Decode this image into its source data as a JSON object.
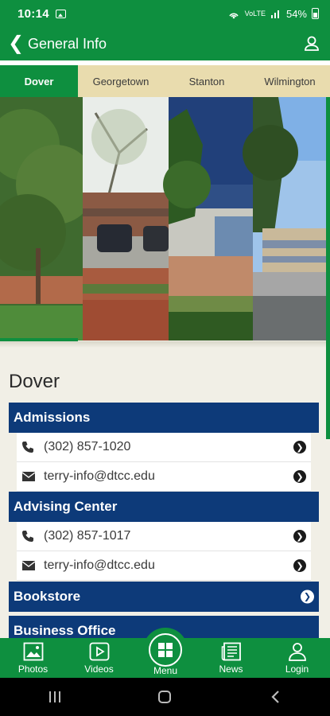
{
  "status_bar": {
    "time": "10:14",
    "signal_text": "VoLTE",
    "battery": "54%"
  },
  "app_bar": {
    "title": "General Info"
  },
  "tabs": [
    {
      "label": "Dover",
      "active": true
    },
    {
      "label": "Georgetown",
      "active": false
    },
    {
      "label": "Stanton",
      "active": false
    },
    {
      "label": "Wilmington",
      "active": false
    }
  ],
  "campus": {
    "name": "Dover"
  },
  "sections": {
    "admissions": {
      "title": "Admissions",
      "phone": "(302) 857-1020",
      "email": "terry-info@dtcc.edu"
    },
    "advising": {
      "title": "Advising Center",
      "phone": "(302) 857-1017",
      "email": "terry-info@dtcc.edu"
    },
    "bookstore": {
      "title": "Bookstore"
    },
    "business": {
      "title": "Business Office"
    }
  },
  "bottom_nav": {
    "photos": "Photos",
    "videos": "Videos",
    "menu": "Menu",
    "news": "News",
    "login": "Login"
  },
  "colors": {
    "brand_green": "#0e8f3f",
    "navy": "#0d3a79",
    "tab_bg": "#e9dcae"
  }
}
